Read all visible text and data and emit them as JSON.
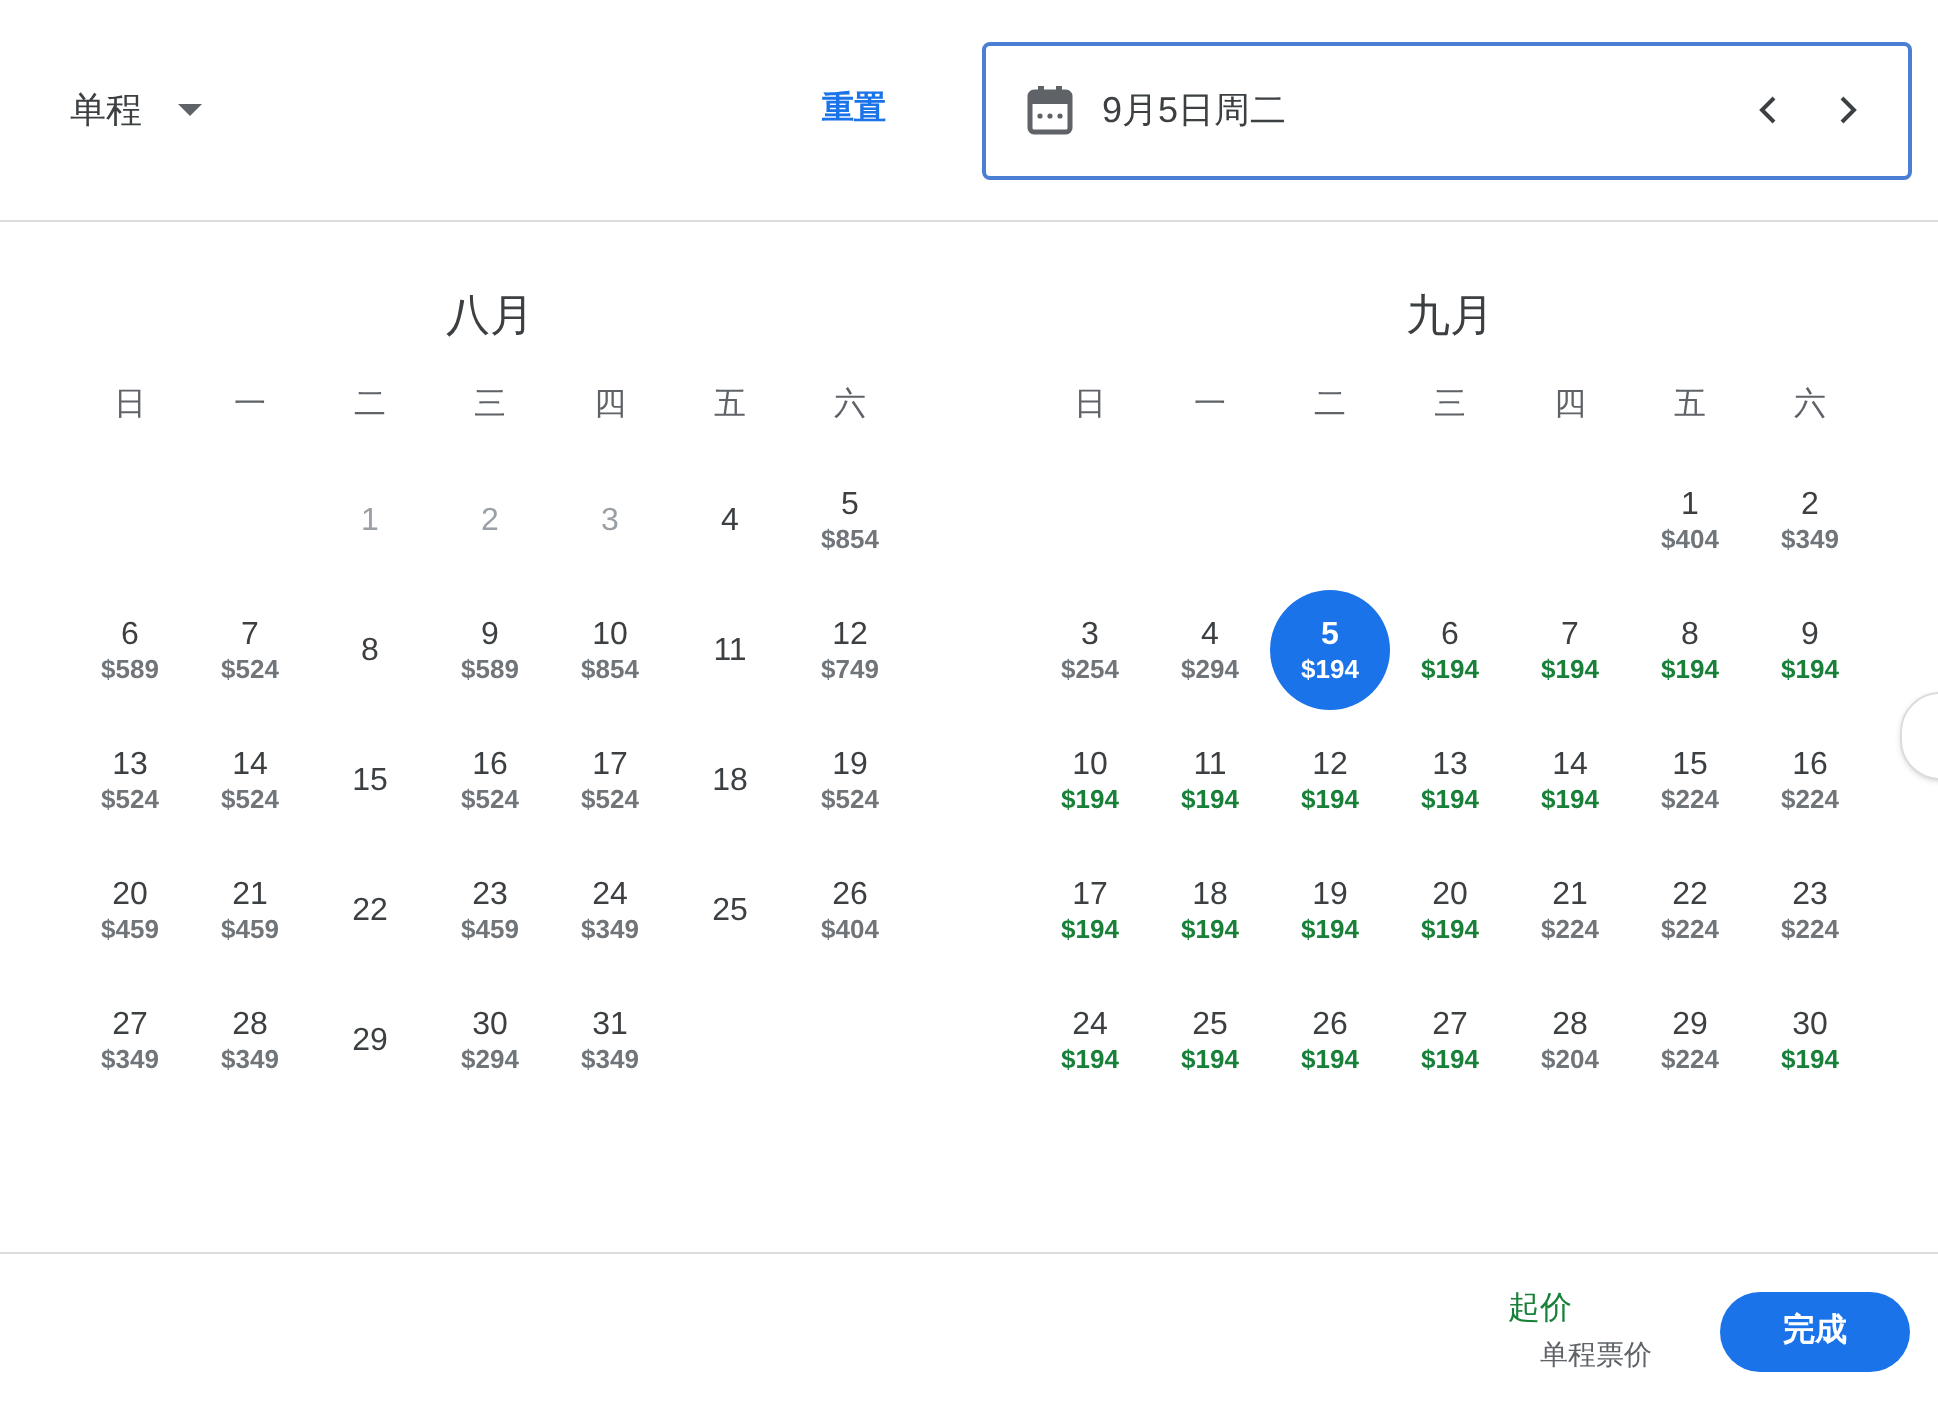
{
  "trip_type": {
    "label": "单程"
  },
  "reset_link": "重置",
  "date_field": {
    "value": "9月5日周二"
  },
  "months": [
    {
      "title": "八月",
      "weekdays": [
        "日",
        "一",
        "二",
        "三",
        "四",
        "五",
        "六"
      ],
      "weeks": [
        [
          {
            "kind": "blank"
          },
          {
            "kind": "blank"
          },
          {
            "kind": "day",
            "day": "1",
            "disabled": true,
            "selected": false
          },
          {
            "kind": "day",
            "day": "2",
            "disabled": true,
            "selected": false
          },
          {
            "kind": "day",
            "day": "3",
            "disabled": true,
            "selected": false
          },
          {
            "kind": "day",
            "day": "4",
            "disabled": false,
            "selected": false
          },
          {
            "kind": "day",
            "day": "5",
            "price": "$854",
            "low": false,
            "disabled": false,
            "selected": false
          }
        ],
        [
          {
            "kind": "day",
            "day": "6",
            "price": "$589",
            "low": false,
            "disabled": false,
            "selected": false
          },
          {
            "kind": "day",
            "day": "7",
            "price": "$524",
            "low": false,
            "disabled": false,
            "selected": false
          },
          {
            "kind": "day",
            "day": "8",
            "disabled": false,
            "selected": false
          },
          {
            "kind": "day",
            "day": "9",
            "price": "$589",
            "low": false,
            "disabled": false,
            "selected": false
          },
          {
            "kind": "day",
            "day": "10",
            "price": "$854",
            "low": false,
            "disabled": false,
            "selected": false
          },
          {
            "kind": "day",
            "day": "11",
            "disabled": false,
            "selected": false
          },
          {
            "kind": "day",
            "day": "12",
            "price": "$749",
            "low": false,
            "disabled": false,
            "selected": false
          }
        ],
        [
          {
            "kind": "day",
            "day": "13",
            "price": "$524",
            "low": false,
            "disabled": false,
            "selected": false
          },
          {
            "kind": "day",
            "day": "14",
            "price": "$524",
            "low": false,
            "disabled": false,
            "selected": false
          },
          {
            "kind": "day",
            "day": "15",
            "disabled": false,
            "selected": false
          },
          {
            "kind": "day",
            "day": "16",
            "price": "$524",
            "low": false,
            "disabled": false,
            "selected": false
          },
          {
            "kind": "day",
            "day": "17",
            "price": "$524",
            "low": false,
            "disabled": false,
            "selected": false
          },
          {
            "kind": "day",
            "day": "18",
            "disabled": false,
            "selected": false
          },
          {
            "kind": "day",
            "day": "19",
            "price": "$524",
            "low": false,
            "disabled": false,
            "selected": false
          }
        ],
        [
          {
            "kind": "day",
            "day": "20",
            "price": "$459",
            "low": false,
            "disabled": false,
            "selected": false
          },
          {
            "kind": "day",
            "day": "21",
            "price": "$459",
            "low": false,
            "disabled": false,
            "selected": false
          },
          {
            "kind": "day",
            "day": "22",
            "disabled": false,
            "selected": false
          },
          {
            "kind": "day",
            "day": "23",
            "price": "$459",
            "low": false,
            "disabled": false,
            "selected": false
          },
          {
            "kind": "day",
            "day": "24",
            "price": "$349",
            "low": false,
            "disabled": false,
            "selected": false
          },
          {
            "kind": "day",
            "day": "25",
            "disabled": false,
            "selected": false
          },
          {
            "kind": "day",
            "day": "26",
            "price": "$404",
            "low": false,
            "disabled": false,
            "selected": false
          }
        ],
        [
          {
            "kind": "day",
            "day": "27",
            "price": "$349",
            "low": false,
            "disabled": false,
            "selected": false
          },
          {
            "kind": "day",
            "day": "28",
            "price": "$349",
            "low": false,
            "disabled": false,
            "selected": false
          },
          {
            "kind": "day",
            "day": "29",
            "disabled": false,
            "selected": false
          },
          {
            "kind": "day",
            "day": "30",
            "price": "$294",
            "low": false,
            "disabled": false,
            "selected": false
          },
          {
            "kind": "day",
            "day": "31",
            "price": "$349",
            "low": false,
            "disabled": false,
            "selected": false
          },
          {
            "kind": "blank"
          },
          {
            "kind": "blank"
          }
        ]
      ]
    },
    {
      "title": "九月",
      "weekdays": [
        "日",
        "一",
        "二",
        "三",
        "四",
        "五",
        "六"
      ],
      "weeks": [
        [
          {
            "kind": "blank"
          },
          {
            "kind": "blank"
          },
          {
            "kind": "blank"
          },
          {
            "kind": "blank"
          },
          {
            "kind": "blank"
          },
          {
            "kind": "day",
            "day": "1",
            "price": "$404",
            "low": false,
            "disabled": false,
            "selected": false
          },
          {
            "kind": "day",
            "day": "2",
            "price": "$349",
            "low": false,
            "disabled": false,
            "selected": false
          }
        ],
        [
          {
            "kind": "day",
            "day": "3",
            "price": "$254",
            "low": false,
            "disabled": false,
            "selected": false
          },
          {
            "kind": "day",
            "day": "4",
            "price": "$294",
            "low": false,
            "disabled": false,
            "selected": false
          },
          {
            "kind": "day",
            "day": "5",
            "price": "$194",
            "low": true,
            "disabled": false,
            "selected": true
          },
          {
            "kind": "day",
            "day": "6",
            "price": "$194",
            "low": true,
            "disabled": false,
            "selected": false
          },
          {
            "kind": "day",
            "day": "7",
            "price": "$194",
            "low": true,
            "disabled": false,
            "selected": false
          },
          {
            "kind": "day",
            "day": "8",
            "price": "$194",
            "low": true,
            "disabled": false,
            "selected": false
          },
          {
            "kind": "day",
            "day": "9",
            "price": "$194",
            "low": true,
            "disabled": false,
            "selected": false
          }
        ],
        [
          {
            "kind": "day",
            "day": "10",
            "price": "$194",
            "low": true,
            "disabled": false,
            "selected": false
          },
          {
            "kind": "day",
            "day": "11",
            "price": "$194",
            "low": true,
            "disabled": false,
            "selected": false
          },
          {
            "kind": "day",
            "day": "12",
            "price": "$194",
            "low": true,
            "disabled": false,
            "selected": false
          },
          {
            "kind": "day",
            "day": "13",
            "price": "$194",
            "low": true,
            "disabled": false,
            "selected": false
          },
          {
            "kind": "day",
            "day": "14",
            "price": "$194",
            "low": true,
            "disabled": false,
            "selected": false
          },
          {
            "kind": "day",
            "day": "15",
            "price": "$224",
            "low": false,
            "disabled": false,
            "selected": false
          },
          {
            "kind": "day",
            "day": "16",
            "price": "$224",
            "low": false,
            "disabled": false,
            "selected": false
          }
        ],
        [
          {
            "kind": "day",
            "day": "17",
            "price": "$194",
            "low": true,
            "disabled": false,
            "selected": false
          },
          {
            "kind": "day",
            "day": "18",
            "price": "$194",
            "low": true,
            "disabled": false,
            "selected": false
          },
          {
            "kind": "day",
            "day": "19",
            "price": "$194",
            "low": true,
            "disabled": false,
            "selected": false
          },
          {
            "kind": "day",
            "day": "20",
            "price": "$194",
            "low": true,
            "disabled": false,
            "selected": false
          },
          {
            "kind": "day",
            "day": "21",
            "price": "$224",
            "low": false,
            "disabled": false,
            "selected": false
          },
          {
            "kind": "day",
            "day": "22",
            "price": "$224",
            "low": false,
            "disabled": false,
            "selected": false
          },
          {
            "kind": "day",
            "day": "23",
            "price": "$224",
            "low": false,
            "disabled": false,
            "selected": false
          }
        ],
        [
          {
            "kind": "day",
            "day": "24",
            "price": "$194",
            "low": true,
            "disabled": false,
            "selected": false
          },
          {
            "kind": "day",
            "day": "25",
            "price": "$194",
            "low": true,
            "disabled": false,
            "selected": false
          },
          {
            "kind": "day",
            "day": "26",
            "price": "$194",
            "low": true,
            "disabled": false,
            "selected": false
          },
          {
            "kind": "day",
            "day": "27",
            "price": "$194",
            "low": true,
            "disabled": false,
            "selected": false
          },
          {
            "kind": "day",
            "day": "28",
            "price": "$204",
            "low": false,
            "disabled": false,
            "selected": false
          },
          {
            "kind": "day",
            "day": "29",
            "price": "$224",
            "low": false,
            "disabled": false,
            "selected": false
          },
          {
            "kind": "day",
            "day": "30",
            "price": "$194",
            "low": true,
            "disabled": false,
            "selected": false
          }
        ]
      ]
    }
  ],
  "footer": {
    "price_label": "起价",
    "price_note": "单程票价",
    "done_button": "完成"
  }
}
